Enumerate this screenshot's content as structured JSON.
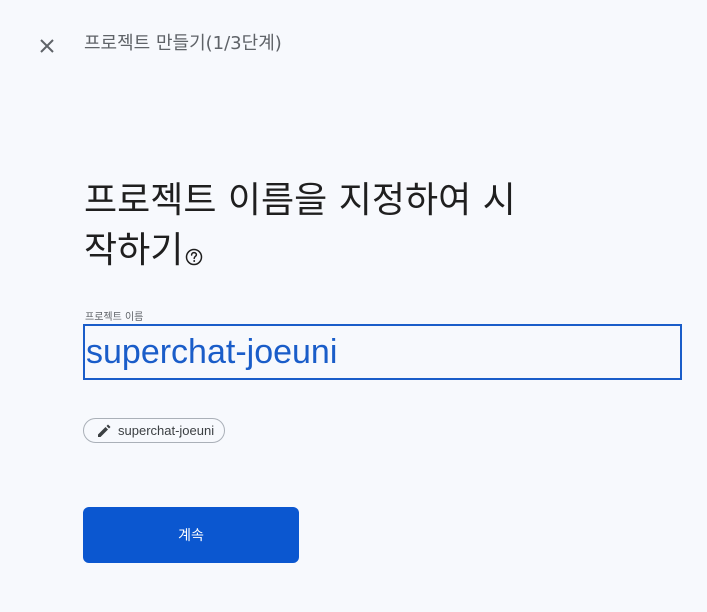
{
  "header": {
    "close_icon": "close-icon",
    "step_title": "프로젝트 만들기(1/3단계)"
  },
  "main": {
    "heading_line1": "프로젝트 이름을 지정하여 시",
    "heading_line2": "작하기",
    "help_icon": "help-circle-icon",
    "project_name_label": "프로젝트 이름",
    "project_name_value": "superchat-joeuni",
    "project_id_chip": "superchat-joeuni",
    "edit_icon": "pencil-icon",
    "continue_label": "계속"
  },
  "colors": {
    "accent": "#0b57d0",
    "input_text": "#1a5dc9",
    "background": "#f7f9fd"
  }
}
